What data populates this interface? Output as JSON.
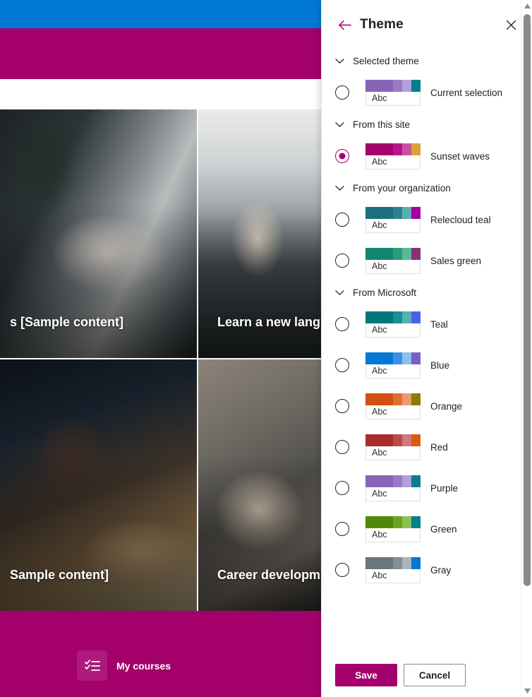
{
  "site": {
    "topbar_color": "#0078d4",
    "navbar_color": "#a4006b",
    "cards": [
      {
        "title": "s [Sample content]"
      },
      {
        "title": "Learn a new lang"
      },
      {
        "title": "Sample content]"
      },
      {
        "title": "Career developm"
      }
    ],
    "footer": {
      "icon": "checklist-icon",
      "label": "My courses"
    }
  },
  "panel": {
    "back_icon": "back-arrow-icon",
    "title": "Theme",
    "close_icon": "close-icon",
    "groups": [
      {
        "label": "Selected theme",
        "chevron": "chevron-down-icon",
        "options": [
          {
            "label": "Current selection",
            "selected": false,
            "sample_text": "Abc",
            "colors": [
              "#8764b8",
              "#9a7ac4",
              "#b79ddb",
              "#00808a"
            ]
          }
        ]
      },
      {
        "label": "From this site",
        "chevron": "chevron-down-icon",
        "options": [
          {
            "label": "Sunset waves",
            "selected": true,
            "sample_text": "Abc",
            "colors": [
              "#a4006b",
              "#b5168b",
              "#c653a2",
              "#d9a13a"
            ]
          }
        ]
      },
      {
        "label": "From your organization",
        "chevron": "chevron-down-icon",
        "options": [
          {
            "label": "Relecloud teal",
            "selected": false,
            "sample_text": "Abc",
            "colors": [
              "#1b6e7d",
              "#2a8190",
              "#60aab4",
              "#a4009e"
            ]
          },
          {
            "label": "Sales green",
            "selected": false,
            "sample_text": "Abc",
            "colors": [
              "#12866f",
              "#2c9b78",
              "#5bb899",
              "#8a3273"
            ]
          }
        ]
      },
      {
        "label": "From Microsoft",
        "chevron": "chevron-down-icon",
        "options": [
          {
            "label": "Teal",
            "selected": false,
            "sample_text": "Abc",
            "colors": [
              "#00767d",
              "#188f93",
              "#52b2ae",
              "#4a62e8"
            ]
          },
          {
            "label": "Blue",
            "selected": false,
            "sample_text": "Abc",
            "colors": [
              "#0078d4",
              "#3a93e0",
              "#8cc0ee",
              "#7a5fc6"
            ]
          },
          {
            "label": "Orange",
            "selected": false,
            "sample_text": "Abc",
            "colors": [
              "#d2500f",
              "#de7036",
              "#eb9b6d",
              "#8a7a09"
            ]
          },
          {
            "label": "Red",
            "selected": false,
            "sample_text": "Abc",
            "colors": [
              "#a82b2e",
              "#bc4a4a",
              "#cf7a80",
              "#da5b0b"
            ]
          },
          {
            "label": "Purple",
            "selected": false,
            "sample_text": "Abc",
            "colors": [
              "#8764b8",
              "#9a7ac4",
              "#b79ddb",
              "#00808a"
            ]
          },
          {
            "label": "Green",
            "selected": false,
            "sample_text": "Abc",
            "colors": [
              "#4f8a0c",
              "#6aa526",
              "#8cc055",
              "#00808a"
            ]
          },
          {
            "label": "Gray",
            "selected": false,
            "sample_text": "Abc",
            "colors": [
              "#69767c",
              "#848e93",
              "#aab4ba",
              "#0078d4"
            ]
          }
        ]
      }
    ],
    "footer": {
      "save_label": "Save",
      "cancel_label": "Cancel",
      "primary_color": "#a4006b"
    },
    "scrollbar": {
      "up_icon": "scroll-up-arrow-icon",
      "down_icon": "scroll-down-arrow-icon"
    }
  }
}
